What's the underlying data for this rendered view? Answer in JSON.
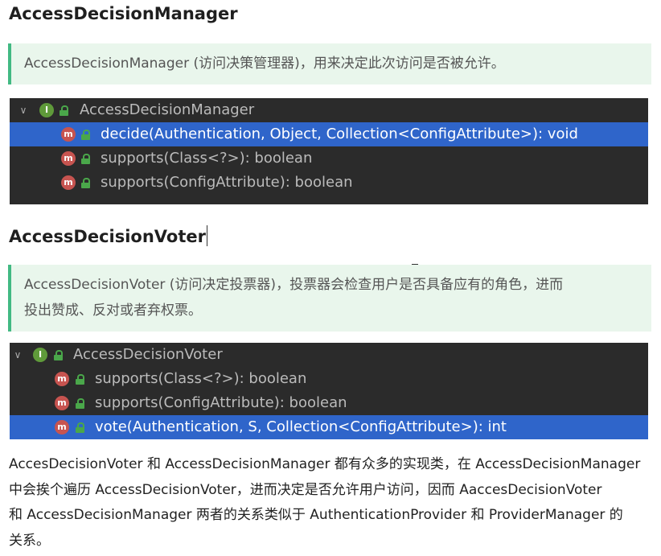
{
  "sections": [
    {
      "heading": "AccessDecisionManager",
      "quote_lines": [
        "AccessDecisionManager (访问决策管理器)，用来决定此次访问是否被允许。"
      ],
      "tree": {
        "root_label": "AccessDecisionManager",
        "root_icon": "interface-icon",
        "methods": [
          {
            "label": "decide(Authentication, Object, Collection<ConfigAttribute>): void",
            "selected": true
          },
          {
            "label": "supports(Class<?>): boolean",
            "selected": false
          },
          {
            "label": "supports(ConfigAttribute): boolean",
            "selected": false
          }
        ]
      }
    },
    {
      "heading": "AccessDecisionVoter",
      "quote_lines": [
        "AccessDecisionVoter (访问决定投票器)，投票器会检查用户是否具备应有的角色，进而",
        "投出赞成、反对或者弃权票。"
      ],
      "tree": {
        "root_label": "AccessDecisionVoter",
        "root_icon": "interface-icon",
        "methods": [
          {
            "label": "supports(Class<?>): boolean",
            "selected": false
          },
          {
            "label": "supports(ConfigAttribute): boolean",
            "selected": false
          },
          {
            "label": "vote(Authentication, S, Collection<ConfigAttribute>): int",
            "selected": true
          }
        ]
      }
    }
  ],
  "paragraph_lines": [
    "AccesDecisionVoter 和 AccessDecisionManager 都有众多的实现类，在 AccessDecisionManager",
    "中会挨个遍历 AccessDecisionVoter，进而决定是否允许用户访问，因而 AaccesDecisionVoter",
    "和 AccessDecisionManager 两者的关系类似于 AuthenticationProvider 和 ProviderManager 的",
    "关系。"
  ],
  "icons": {
    "interface_letter": "I",
    "method_letter": "m"
  },
  "colors": {
    "quote_bg": "#e9f6ec",
    "quote_border": "#42b983",
    "tree_bg": "#2b2b2b",
    "selected_row": "#2f65ca",
    "method_icon": "#c75450",
    "interface_icon": "#5f9a3a"
  }
}
